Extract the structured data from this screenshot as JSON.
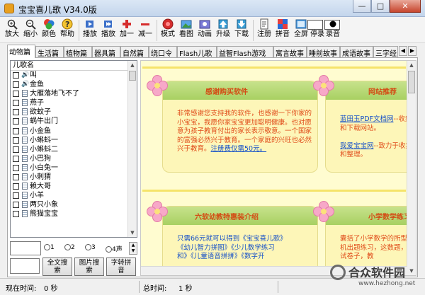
{
  "window": {
    "title": "宝宝喜儿歌 V34.0版"
  },
  "toolbar": {
    "buttons": [
      {
        "label": "放大",
        "icon": "zoom-in-icon"
      },
      {
        "label": "缩小",
        "icon": "zoom-out-icon"
      },
      {
        "label": "颜色",
        "icon": "color-icon"
      },
      {
        "label": "帮助",
        "icon": "help-icon"
      },
      {
        "label": "播放",
        "icon": "play-icon"
      },
      {
        "label": "播放",
        "icon": "play-all-icon"
      },
      {
        "label": "加一",
        "icon": "plus-icon"
      },
      {
        "label": "减一",
        "icon": "minus-icon"
      },
      {
        "label": "模式",
        "icon": "mode-icon"
      },
      {
        "label": "看图",
        "icon": "picture-icon"
      },
      {
        "label": "动画",
        "icon": "animation-icon"
      },
      {
        "label": "升级",
        "icon": "upgrade-icon"
      },
      {
        "label": "下载",
        "icon": "download-icon"
      },
      {
        "label": "注册",
        "icon": "register-icon"
      },
      {
        "label": "拼音",
        "icon": "pinyin-icon"
      },
      {
        "label": "全屏",
        "icon": "fullscreen-icon"
      },
      {
        "label": "停录",
        "icon": "stop-record-icon"
      },
      {
        "label": "录音",
        "icon": "record-icon"
      }
    ]
  },
  "tabs": [
    "动物篇",
    "生活篇",
    "植物篇",
    "器具篇",
    "自然篇",
    "绕口令",
    "Flash儿歌",
    "益智Flash游戏",
    "寓言故事",
    "睡前故事",
    "成语故事",
    "三字经"
  ],
  "song_list": {
    "header": "儿歌名",
    "items": [
      {
        "name": "叫",
        "icon": "speaker"
      },
      {
        "name": "金鱼",
        "icon": "speaker"
      },
      {
        "name": "大雁落地飞不了",
        "icon": "doc"
      },
      {
        "name": "燕子",
        "icon": "doc"
      },
      {
        "name": "欲蚊子",
        "icon": "doc"
      },
      {
        "name": "蜗牛出门",
        "icon": "doc"
      },
      {
        "name": "小金鱼",
        "icon": "doc"
      },
      {
        "name": "小蝌蚪一",
        "icon": "doc"
      },
      {
        "name": "小蝌蚪二",
        "icon": "doc"
      },
      {
        "name": "小巴狗",
        "icon": "doc"
      },
      {
        "name": "小白兔一",
        "icon": "doc"
      },
      {
        "name": "小刺猬",
        "icon": "doc"
      },
      {
        "name": "赖大哥",
        "icon": "doc"
      },
      {
        "name": "小羊",
        "icon": "doc"
      },
      {
        "name": "两只小象",
        "icon": "doc"
      },
      {
        "name": "熊猫宝宝",
        "icon": "doc"
      }
    ]
  },
  "radios": [
    "1",
    "2",
    "3",
    "4"
  ],
  "radio_tail": "声",
  "search_buttons": [
    {
      "line1": "全文搜",
      "line2": "索"
    },
    {
      "line1": "图片搜",
      "line2": "索"
    },
    {
      "line1": "字转拼",
      "line2": "音"
    }
  ],
  "cards": {
    "c1": {
      "title": "感谢购买软件",
      "body": "非常感谢您支持我的软件，也感谢一下你家的小宝宝，我愿你家宝宝更加聪明健康。也对愿意为孩子教育付出的家长表示敬意。一个国家的富强必然兴于教育。一个家庭的兴旺也必然兴于教育。",
      "link": "注册费仅需50元。"
    },
    "c2": {
      "title": "网站推荐",
      "link1": "蓝田玉PDF文档网",
      "body1": "--收集和下载网站。",
      "link2": "我爱宝宝网",
      "body2": "--致力于收集和整理。"
    },
    "c3": {
      "title": "六软幼教特惠装介绍",
      "line1": "只需66元就可以得到《宝宝喜儿歌》",
      "line2": "《幼儿智力拼图》《少儿数学练习",
      "line3": "和》《儿童语音拼拼》《数字开"
    },
    "c4": {
      "title": "小学数学练习",
      "body": "囊括了小学数学的所型随机出题练习，这数题，考试卷子，教"
    }
  },
  "status": {
    "current_time_label": "现在时间:",
    "current_time_value": "0 秒",
    "total_time_label": "总时间:",
    "total_time_value": "1 秒"
  },
  "watermark": {
    "text": "合众软件园",
    "url": "www.hezhong.net"
  }
}
